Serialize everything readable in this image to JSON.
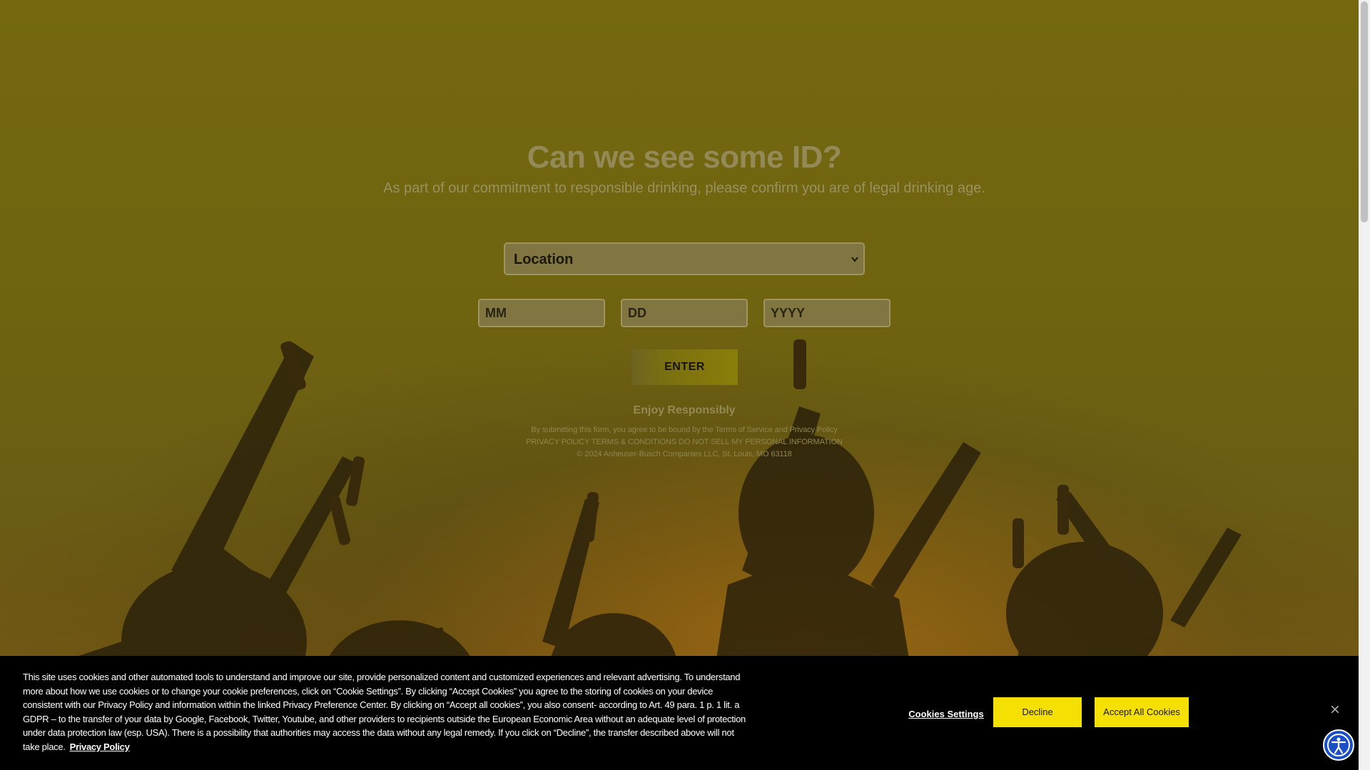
{
  "age_gate": {
    "title": "Can we see some ID?",
    "subtitle": "As part of our commitment to responsible drinking, please confirm you are of legal drinking age.",
    "location_placeholder": "Location",
    "month_placeholder": "MM",
    "day_placeholder": "DD",
    "year_placeholder": "YYYY",
    "enter_label": "ENTER",
    "enjoy_text": "Enjoy Responsibly",
    "terms_line": "By submitting this form, you agree to be bound by the Terms of Service and Privacy Policy",
    "links_line": "PRIVACY POLICY TERMS & CONDITIONS DO NOT SELL MY PERSONAL INFORMATION",
    "copyright": "© 2024 Anheuser-Busch Companies LLC, St. Louis, MO 63118"
  },
  "cookie_banner": {
    "text": "This site uses cookies and other automated tools to understand and improve our site, provide personalized content and customized experiences and relevant advertising. To understand more about how we use cookies or to change your cookie preferences, click on “Cookie Settings”. By clicking “Accept Cookies” you agree to the storing of cookies on your device consistent with our Privacy Policy and information within the linked Privacy Preference Center. By clicking on “Accept all cookies”, you also consent- according to Art. 49 para. 1 p. 1 lit. a GDPR – to the transfer of your data by Google, Facebook, Twitter, Youtube, and other providers to recipients outside the European Economic Area without an adequate level of protection under data protection law (esp. USA). There is a possibility that authorities may access the data without any legal remedy. If you click on “Decline”, the transfer described above will not take place.",
    "privacy_link": "Privacy Policy",
    "settings_label": "Cookies Settings",
    "decline_label": "Decline",
    "accept_label": "Accept All Cookies",
    "close_glyph": "×"
  },
  "colors": {
    "overlay": "#6f6310",
    "accent_yellow": "#f5e003",
    "banner_bg": "#000000",
    "accessibility_blue": "#1a4fc8"
  },
  "icons": {
    "location_chevron": "chevron-down-icon",
    "close": "close-icon",
    "accessibility": "accessibility-icon"
  }
}
